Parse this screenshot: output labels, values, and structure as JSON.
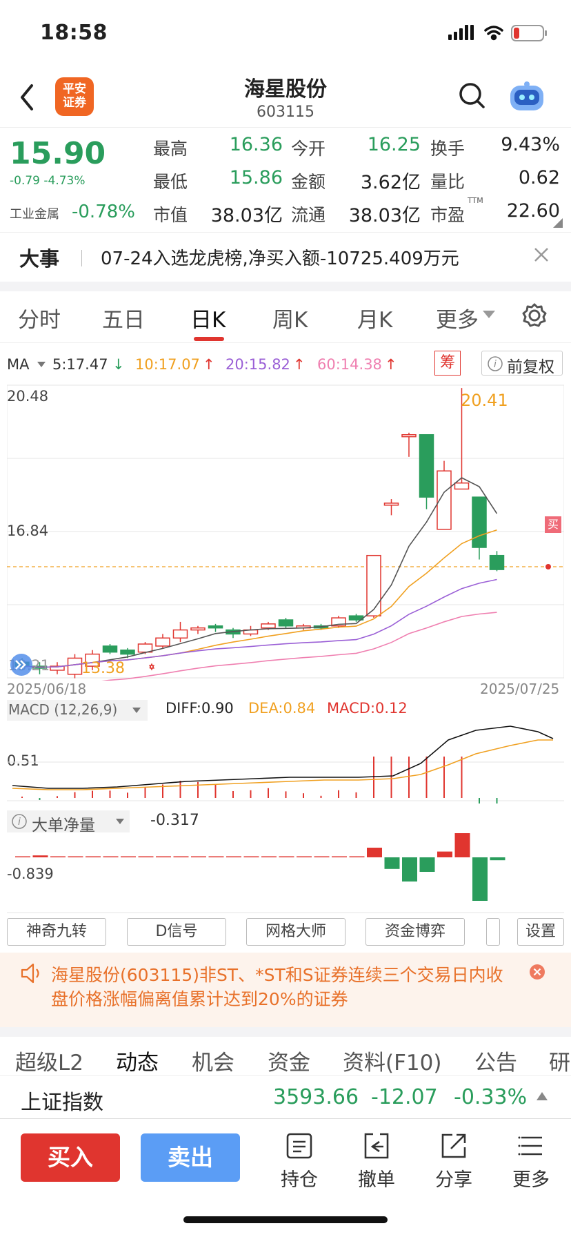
{
  "status_bar": {
    "time": "18:58"
  },
  "header": {
    "title": "海星股份",
    "code": "603115",
    "broker_logo": "平安\n证券"
  },
  "quote": {
    "price": "15.90",
    "change": "-0.79 -4.73%",
    "sector_label": "工业金属",
    "sector_change": "-0.78%",
    "stats": [
      {
        "label": "最高",
        "value": "16.36",
        "color": "green"
      },
      {
        "label": "今开",
        "value": "16.25",
        "color": "green"
      },
      {
        "label": "换手",
        "value": "9.43%",
        "color": "black"
      },
      {
        "label": "最低",
        "value": "15.86",
        "color": "green"
      },
      {
        "label": "金额",
        "value": "3.62亿",
        "color": "black"
      },
      {
        "label": "量比",
        "value": "0.62",
        "color": "black"
      },
      {
        "label": "市值",
        "value": "38.03亿",
        "color": "black"
      },
      {
        "label": "流通",
        "value": "38.03亿",
        "color": "black"
      },
      {
        "label": "市盈",
        "value": "22.60",
        "color": "black",
        "sup": "TTM"
      }
    ]
  },
  "news": {
    "label": "大事",
    "text": "07-24入选龙虎榜,净买入额-10725.409万元"
  },
  "chart_tabs": [
    "分时",
    "五日",
    "日K",
    "周K",
    "月K",
    "更多"
  ],
  "active_tab": "日K",
  "ma": {
    "label": "MA",
    "ma5": "5:17.47",
    "ma10": "10:17.07",
    "ma20": "20:15.82",
    "ma60": "60:14.38",
    "chips": "筹",
    "fq": "前复权"
  },
  "kline": {
    "ymax_label": "20.48",
    "ymid_label": "16.84",
    "ymin_label": "13.21",
    "high_marker": "20.41",
    "low_marker": "13.38",
    "start_date": "2025/06/18",
    "end_date": "2025/07/25",
    "buy_marker": "买"
  },
  "macd": {
    "label": "MACD (12,26,9)",
    "diff": "DIFF:0.90",
    "dea": "DEA:0.84",
    "macd": "MACD:0.12",
    "ylabel": "0.51"
  },
  "bigorder": {
    "label": "大单净量",
    "value": "-0.317",
    "ylabel": "-0.839"
  },
  "tools": [
    "神奇九转",
    "D信号",
    "网格大师",
    "资金博弈",
    "设置"
  ],
  "warning": "海星股份(603115)非ST、*ST和S证券连续三个交易日内收盘价格涨幅偏离值累计达到20%的证券",
  "bottom_tabs": [
    "超级L2",
    "动态",
    "机会",
    "资金",
    "资料(F10)",
    "公告",
    "研"
  ],
  "index": {
    "name": "上证指数",
    "value": "3593.66",
    "change": "-12.07",
    "pct": "-0.33%"
  },
  "footer": {
    "buy": "买入",
    "sell": "卖出",
    "hold": "持仓",
    "cancel": "撤单",
    "share": "分享",
    "more": "更多"
  },
  "colors": {
    "up": "#e0352f",
    "down": "#2a9d5c",
    "accent": "#e0352f",
    "sell_btn": "#5b9df5"
  },
  "chart_data": {
    "type": "candlestick",
    "x_start": "2025/06/18",
    "x_end": "2025/07/25",
    "ylim": [
      13.21,
      20.48
    ],
    "candles": [
      {
        "o": 13.6,
        "c": 13.5,
        "h": 13.7,
        "l": 13.4
      },
      {
        "o": 13.5,
        "c": 13.45,
        "h": 13.6,
        "l": 13.3
      },
      {
        "o": 13.4,
        "c": 13.5,
        "h": 13.6,
        "l": 13.3
      },
      {
        "o": 13.3,
        "c": 13.7,
        "h": 13.8,
        "l": 13.2
      },
      {
        "o": 13.5,
        "c": 13.8,
        "h": 13.9,
        "l": 13.4
      },
      {
        "o": 14.0,
        "c": 13.85,
        "h": 14.05,
        "l": 13.8
      },
      {
        "o": 13.9,
        "c": 13.8,
        "h": 13.95,
        "l": 13.7
      },
      {
        "o": 13.85,
        "c": 14.05,
        "h": 14.1,
        "l": 13.8
      },
      {
        "o": 14.0,
        "c": 14.2,
        "h": 14.3,
        "l": 13.95
      },
      {
        "o": 14.2,
        "c": 14.4,
        "h": 14.6,
        "l": 14.1
      },
      {
        "o": 14.4,
        "c": 14.45,
        "h": 14.5,
        "l": 14.3
      },
      {
        "o": 14.5,
        "c": 14.45,
        "h": 14.55,
        "l": 14.35
      },
      {
        "o": 14.4,
        "c": 14.3,
        "h": 14.45,
        "l": 14.2
      },
      {
        "o": 14.3,
        "c": 14.4,
        "h": 14.5,
        "l": 14.25
      },
      {
        "o": 14.45,
        "c": 14.55,
        "h": 14.6,
        "l": 14.4
      },
      {
        "o": 14.65,
        "c": 14.5,
        "h": 14.7,
        "l": 14.45
      },
      {
        "o": 14.45,
        "c": 14.5,
        "h": 14.55,
        "l": 14.4
      },
      {
        "o": 14.5,
        "c": 14.45,
        "h": 14.55,
        "l": 14.4
      },
      {
        "o": 14.5,
        "c": 14.7,
        "h": 14.75,
        "l": 14.45
      },
      {
        "o": 14.75,
        "c": 14.65,
        "h": 14.8,
        "l": 14.6
      },
      {
        "o": 14.75,
        "c": 16.25,
        "h": 16.25,
        "l": 14.7
      },
      {
        "o": 17.5,
        "c": 17.55,
        "h": 17.65,
        "l": 17.25
      },
      {
        "o": 19.2,
        "c": 19.25,
        "h": 19.3,
        "l": 18.7
      },
      {
        "o": 19.25,
        "c": 17.7,
        "h": 19.25,
        "l": 17.4
      },
      {
        "o": 16.9,
        "c": 18.35,
        "h": 18.6,
        "l": 16.9
      },
      {
        "o": 17.9,
        "c": 18.05,
        "h": 20.41,
        "l": 17.9
      },
      {
        "o": 17.7,
        "c": 16.45,
        "h": 17.7,
        "l": 16.15
      },
      {
        "o": 16.25,
        "c": 15.9,
        "h": 16.36,
        "l": 15.86
      }
    ]
  }
}
